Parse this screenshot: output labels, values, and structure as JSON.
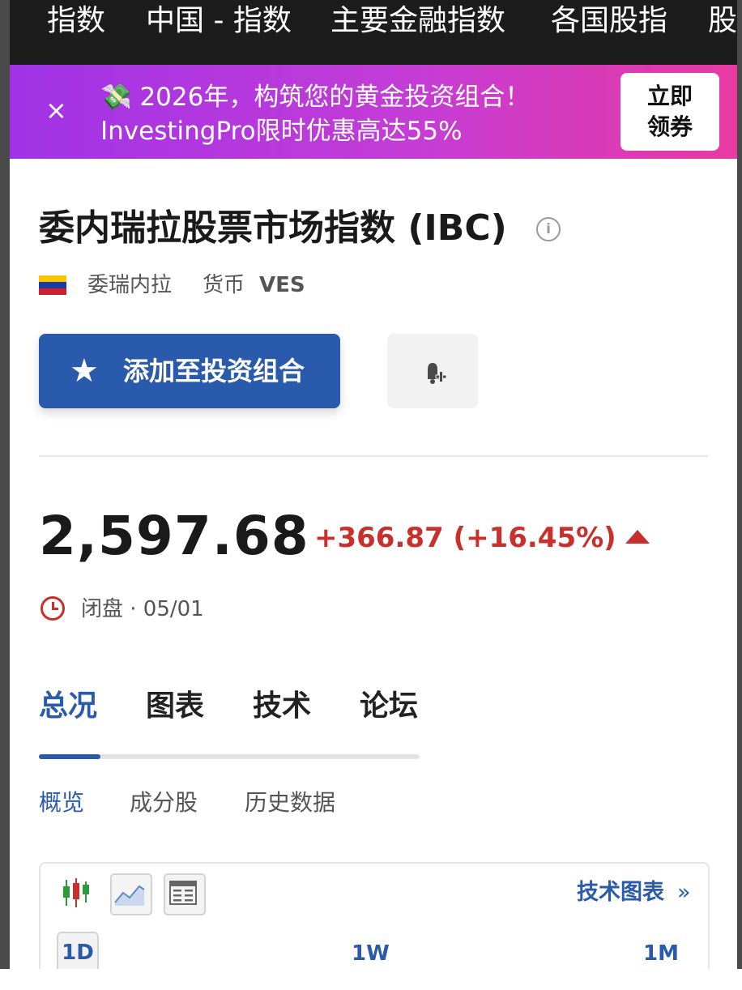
{
  "topnav": {
    "items": [
      "指数",
      "中国 - 指数",
      "主要金融指数",
      "各国股指",
      "股"
    ]
  },
  "promo": {
    "close_label": "×",
    "line1": "💸 2026年，构筑您的黄金投资组合！",
    "line2": "InvestingPro限时优惠高达55%",
    "cta_line1": "立即",
    "cta_line2": "领券",
    "colors": {
      "gradient_start": "#a033e6",
      "gradient_end": "#e83aa2"
    }
  },
  "header": {
    "title": "委内瑞拉股票市场指数 (IBC)",
    "info_glyph": "i",
    "country": "委瑞内拉",
    "currency_label": "货币",
    "currency_value": "VES",
    "flag_colors": [
      "#f6c600",
      "#1e3a9e",
      "#cf1f2e"
    ]
  },
  "actions": {
    "add_portfolio_label": "添加至投资组合",
    "star_glyph": "★"
  },
  "quote": {
    "price": "2,597.68",
    "change": "+366.87 (+16.45%)",
    "direction": "up",
    "status": "闭盘 · 05/01",
    "colors": {
      "up": "#c8312b"
    }
  },
  "tabs": [
    "总况",
    "图表",
    "技术",
    "论坛"
  ],
  "subtabs": [
    "概览",
    "成分股",
    "历史数据"
  ],
  "chart_card": {
    "tech_chart_link": "技术图表",
    "chevron": "»",
    "periods": [
      "1D",
      "1W",
      "1M"
    ],
    "active_period": "1D"
  },
  "accent_color": "#2a5aab"
}
